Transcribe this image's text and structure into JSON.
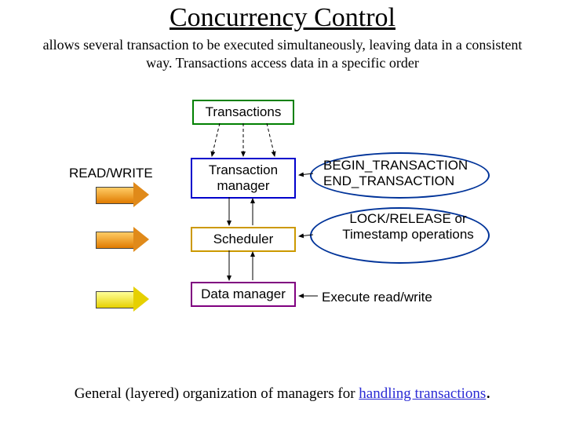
{
  "title": "Concurrency Control",
  "subtitle": "allows several transaction to be executed simultaneously, leaving data in a consistent way. Transactions access data in a specific order",
  "boxes": {
    "transactions": "Transactions",
    "tx_manager": "Transaction manager",
    "scheduler": "Scheduler",
    "data_manager": "Data manager"
  },
  "labels": {
    "read_write": "READ/WRITE",
    "begin_end": "BEGIN_TRANSACTION END_TRANSACTION",
    "lock_release": "LOCK/RELEASE or Timestamp operations",
    "exec_rw": "Execute read/write"
  },
  "caption_prefix": "General (layered) organization of managers for ",
  "caption_link": "handling transactions",
  "caption_suffix": "."
}
